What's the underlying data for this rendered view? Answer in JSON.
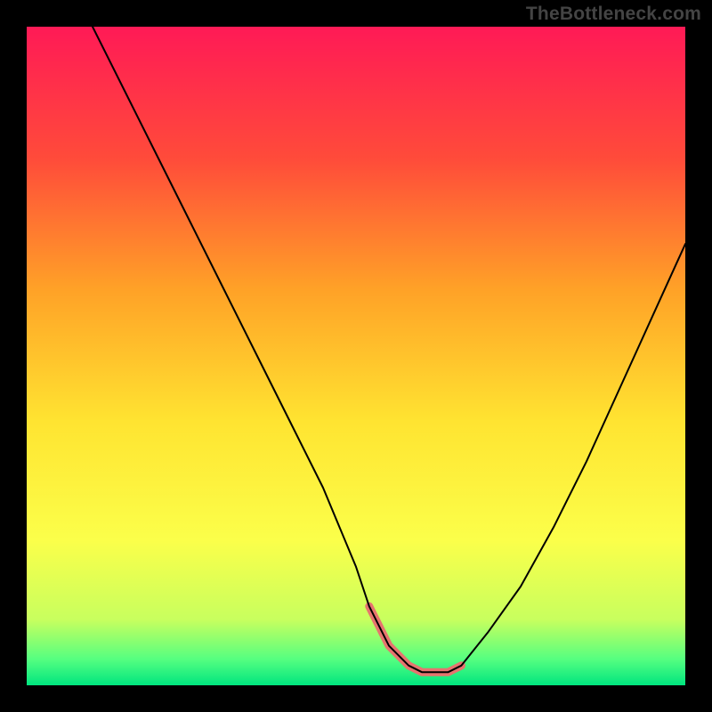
{
  "watermark": "TheBottleneck.com",
  "chart_data": {
    "type": "line",
    "title": "",
    "xlabel": "",
    "ylabel": "",
    "xlim": [
      0,
      100
    ],
    "ylim": [
      0,
      100
    ],
    "grid": false,
    "legend": false,
    "background_gradient_stops": [
      {
        "offset": 0.0,
        "color": "#ff1a56"
      },
      {
        "offset": 0.2,
        "color": "#ff4b3a"
      },
      {
        "offset": 0.4,
        "color": "#ffa227"
      },
      {
        "offset": 0.6,
        "color": "#ffe431"
      },
      {
        "offset": 0.78,
        "color": "#fbff4a"
      },
      {
        "offset": 0.9,
        "color": "#c8ff5e"
      },
      {
        "offset": 0.96,
        "color": "#56ff80"
      },
      {
        "offset": 1.0,
        "color": "#00e57f"
      }
    ],
    "series": [
      {
        "name": "curve",
        "stroke": "#000000",
        "stroke_width": 2,
        "x": [
          10,
          15,
          20,
          25,
          30,
          35,
          40,
          45,
          50,
          52,
          55,
          58,
          60,
          62,
          64,
          66,
          70,
          75,
          80,
          85,
          90,
          95,
          100
        ],
        "y": [
          100,
          90,
          80,
          70,
          60,
          50,
          40,
          30,
          18,
          12,
          6,
          3,
          2,
          2,
          2,
          3,
          8,
          15,
          24,
          34,
          45,
          56,
          67
        ]
      },
      {
        "name": "highlight",
        "stroke": "#e6746f",
        "stroke_width": 9,
        "x": [
          52,
          55,
          58,
          60,
          62,
          64,
          66
        ],
        "y": [
          12,
          6,
          3,
          2,
          2,
          2,
          3
        ]
      }
    ]
  }
}
